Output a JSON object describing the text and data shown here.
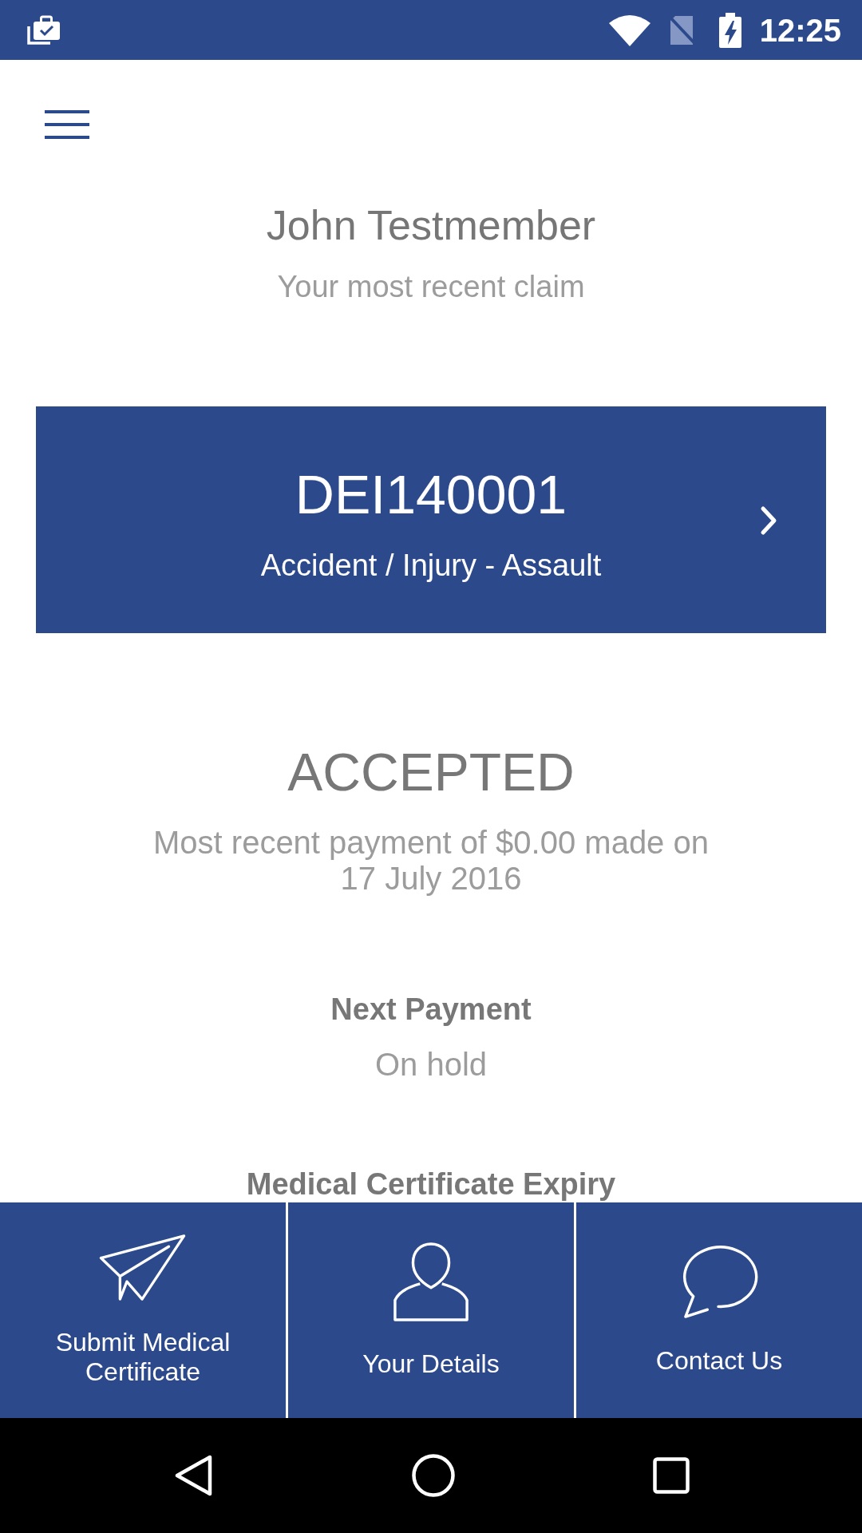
{
  "status_bar": {
    "time": "12:25"
  },
  "header": {
    "name": "John Testmember",
    "subtitle": "Your most recent claim"
  },
  "claim_card": {
    "claim_number": "DEI140001",
    "claim_type": "Accident / Injury - Assault"
  },
  "claim_status": {
    "status": "ACCEPTED",
    "payment_note": "Most recent payment of $0.00 made on 17 July 2016"
  },
  "details": [
    {
      "label": "Next Payment",
      "value": "On hold"
    },
    {
      "label": "Medical Certificate Expiry"
    }
  ],
  "bottom_nav": [
    {
      "kind": "plane",
      "label": "Submit Medical Certificate"
    },
    {
      "kind": "person",
      "label": "Your Details"
    },
    {
      "kind": "chat",
      "label": "Contact Us"
    }
  ]
}
